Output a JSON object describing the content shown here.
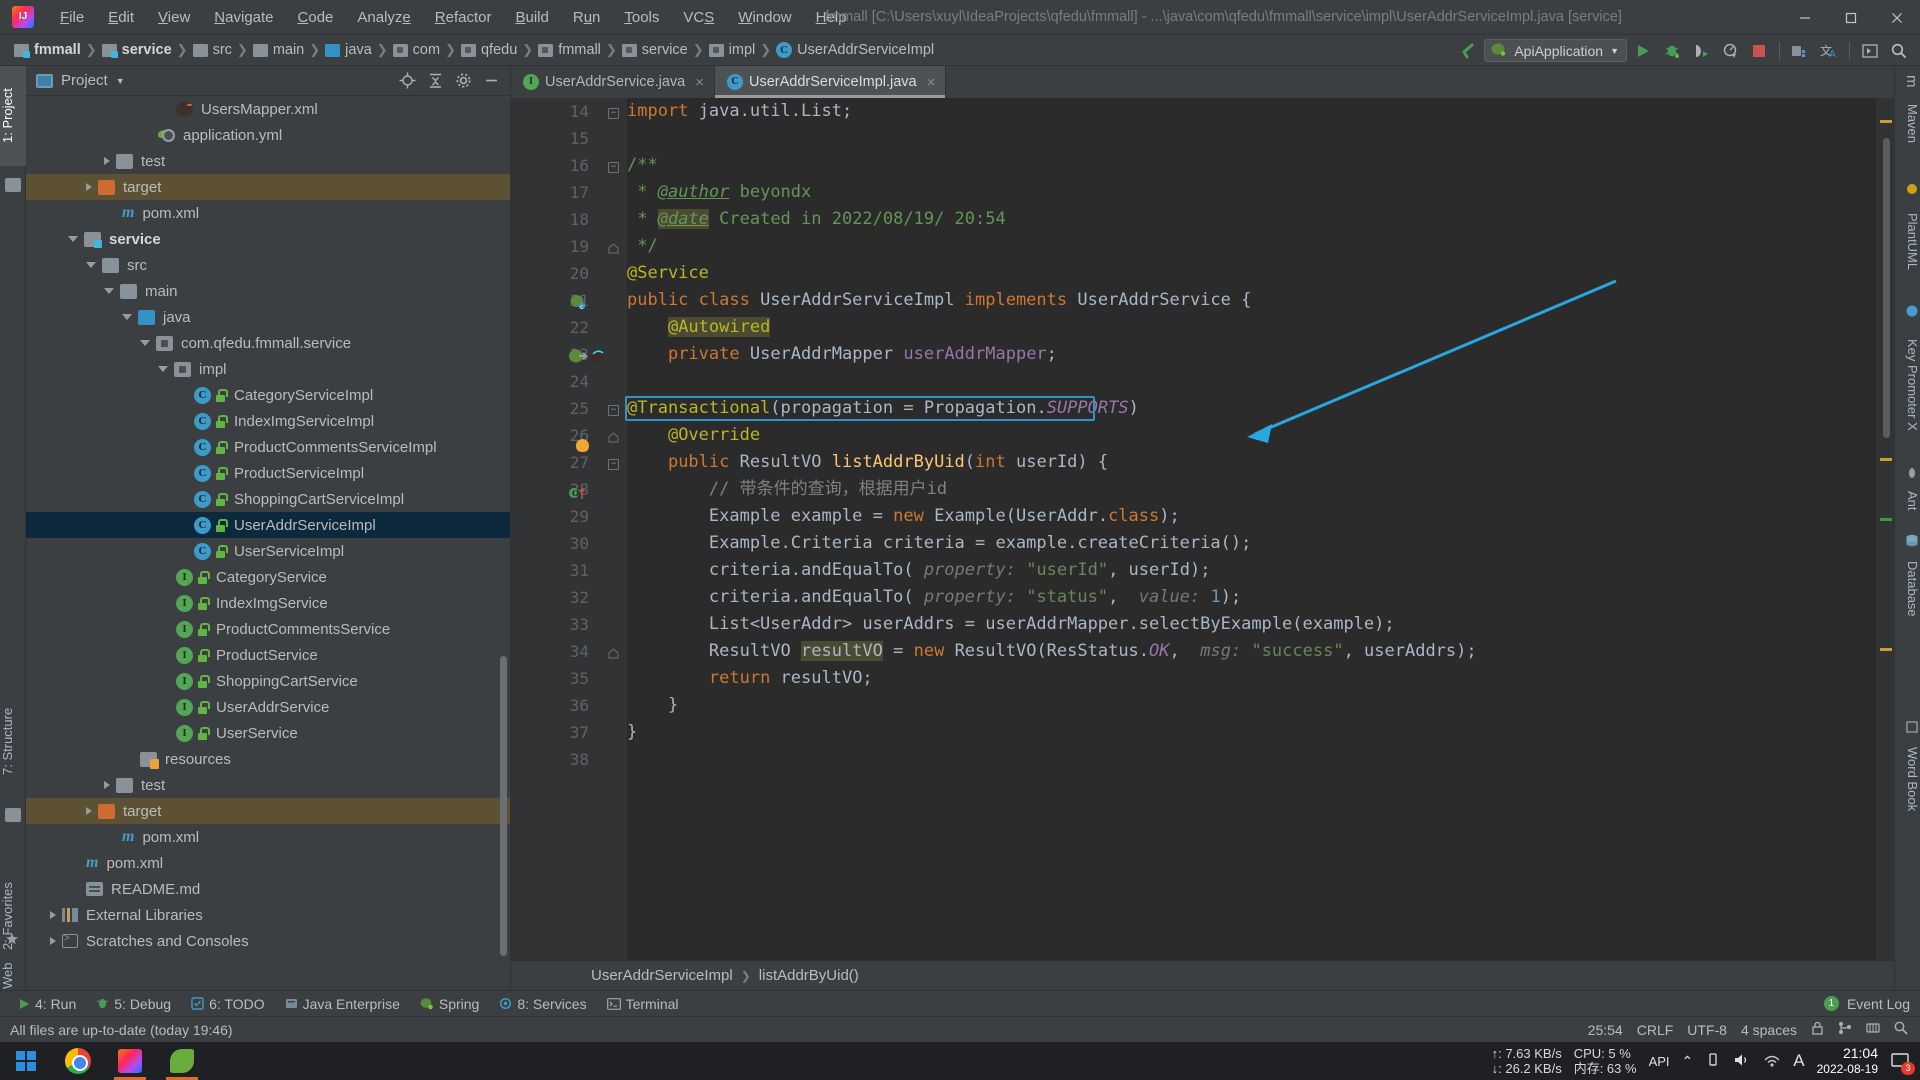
{
  "window": {
    "title": "fmmall [C:\\Users\\xuyl\\IdeaProjects\\qfedu\\fmmall] - ...\\java\\com\\qfedu\\fmmall\\service\\impl\\UserAddrServiceImpl.java [service]",
    "logo_icon": "intellij-idea-logo",
    "minimize_icon": "minimize-icon",
    "maximize_icon": "maximize-icon",
    "close_icon": "close-icon"
  },
  "menu": [
    {
      "label": "File"
    },
    {
      "label": "Edit"
    },
    {
      "label": "View"
    },
    {
      "label": "Navigate"
    },
    {
      "label": "Code"
    },
    {
      "label": "Analyze"
    },
    {
      "label": "Refactor"
    },
    {
      "label": "Build"
    },
    {
      "label": "Run"
    },
    {
      "label": "Tools"
    },
    {
      "label": "VCS"
    },
    {
      "label": "Window"
    },
    {
      "label": "Help"
    }
  ],
  "breadcrumb": [
    {
      "label": "fmmall",
      "icon": "module-icon",
      "bold": true
    },
    {
      "label": "service",
      "icon": "module-icon",
      "bold": true
    },
    {
      "label": "src",
      "icon": "folder-icon",
      "bold": false
    },
    {
      "label": "main",
      "icon": "folder-icon",
      "bold": false
    },
    {
      "label": "java",
      "icon": "source-folder-icon",
      "bold": false
    },
    {
      "label": "com",
      "icon": "package-icon",
      "bold": false
    },
    {
      "label": "qfedu",
      "icon": "package-icon",
      "bold": false
    },
    {
      "label": "fmmall",
      "icon": "package-icon",
      "bold": false
    },
    {
      "label": "service",
      "icon": "package-icon",
      "bold": false
    },
    {
      "label": "impl",
      "icon": "package-icon",
      "bold": false
    },
    {
      "label": "UserAddrServiceImpl",
      "icon": "class-icon",
      "bold": false
    }
  ],
  "toolbar": {
    "back_icon": "back-arrow-icon",
    "run_config": "ApiApplication",
    "run_config_icon": "spring-boot-icon",
    "dropdown_icon": "chevron-down-icon",
    "buttons": [
      {
        "name": "run-button",
        "icon": "play-icon"
      },
      {
        "name": "debug-button",
        "icon": "bug-icon"
      },
      {
        "name": "run-with-coverage-button",
        "icon": "coverage-icon"
      },
      {
        "name": "profile-button",
        "icon": "profiler-icon"
      },
      {
        "name": "stop-button",
        "icon": "stop-icon"
      },
      {
        "name": "project-structure-button",
        "icon": "project-structure-icon"
      },
      {
        "name": "translate-button",
        "icon": "translate-icon"
      },
      {
        "name": "layout-button",
        "icon": "layout-icon"
      },
      {
        "name": "search-everywhere-button",
        "icon": "search-icon"
      }
    ]
  },
  "left_strip": [
    {
      "label": "1: Project",
      "selected": true
    },
    {
      "label": "7: Structure",
      "selected": false
    },
    {
      "label": "2: Favorites",
      "selected": false
    },
    {
      "label": "Web",
      "selected": false
    }
  ],
  "right_strip": [
    {
      "label": "m",
      "name": "maven-tab"
    },
    {
      "label": "Maven",
      "name": "maven-label-tab"
    },
    {
      "label": "PlantUML",
      "name": "plantuml-tab"
    },
    {
      "label": "Key Promoter X",
      "name": "key-promoter-tab"
    },
    {
      "label": "Ant",
      "name": "ant-tab"
    },
    {
      "label": "Database",
      "name": "database-tab"
    },
    {
      "label": "Word Book",
      "name": "word-book-tab"
    }
  ],
  "project_panel": {
    "title": "Project",
    "dropdown_icon": "chevron-down-icon",
    "locate_icon": "locate-icon",
    "collapse_icon": "collapse-all-icon",
    "settings_icon": "gear-icon",
    "hide_icon": "hide-icon",
    "tree": [
      {
        "label": "UsersMapper.xml",
        "indent": 7,
        "icon": "xml-mapper-icon",
        "arrow": "none",
        "state": "none"
      },
      {
        "label": "application.yml",
        "indent": 6,
        "icon": "yml-icon",
        "arrow": "none",
        "state": "none"
      },
      {
        "label": "test",
        "indent": 4,
        "icon": "folder-icon",
        "arrow": "right",
        "state": "none"
      },
      {
        "label": "target",
        "indent": 3,
        "icon": "folder-orange-icon",
        "arrow": "right",
        "state": "highlighted"
      },
      {
        "label": "pom.xml",
        "indent": 4,
        "icon": "maven-icon",
        "arrow": "none",
        "state": "none"
      },
      {
        "label": "service",
        "indent": 2,
        "icon": "module-icon",
        "arrow": "down",
        "state": "bold"
      },
      {
        "label": "src",
        "indent": 3,
        "icon": "folder-icon",
        "arrow": "down",
        "state": "none"
      },
      {
        "label": "main",
        "indent": 4,
        "icon": "folder-icon",
        "arrow": "down",
        "state": "none"
      },
      {
        "label": "java",
        "indent": 5,
        "icon": "source-folder-icon",
        "arrow": "down",
        "state": "none"
      },
      {
        "label": "com.qfedu.fmmall.service",
        "indent": 6,
        "icon": "package-icon",
        "arrow": "down",
        "state": "none"
      },
      {
        "label": "impl",
        "indent": 7,
        "icon": "package-icon",
        "arrow": "down",
        "state": "none"
      },
      {
        "label": "CategoryServiceImpl",
        "indent": 8,
        "icon": "class-icon",
        "arrow": "none",
        "state": "none"
      },
      {
        "label": "IndexImgServiceImpl",
        "indent": 8,
        "icon": "class-icon",
        "arrow": "none",
        "state": "none"
      },
      {
        "label": "ProductCommentsServiceImpl",
        "indent": 8,
        "icon": "class-icon",
        "arrow": "none",
        "state": "none"
      },
      {
        "label": "ProductServiceImpl",
        "indent": 8,
        "icon": "class-icon",
        "arrow": "none",
        "state": "none"
      },
      {
        "label": "ShoppingCartServiceImpl",
        "indent": 8,
        "icon": "class-icon",
        "arrow": "none",
        "state": "none"
      },
      {
        "label": "UserAddrServiceImpl",
        "indent": 8,
        "icon": "class-icon",
        "arrow": "none",
        "state": "selected"
      },
      {
        "label": "UserServiceImpl",
        "indent": 8,
        "icon": "class-icon",
        "arrow": "none",
        "state": "none"
      },
      {
        "label": "CategoryService",
        "indent": 7,
        "icon": "interface-icon",
        "arrow": "none",
        "state": "none"
      },
      {
        "label": "IndexImgService",
        "indent": 7,
        "icon": "interface-icon",
        "arrow": "none",
        "state": "none"
      },
      {
        "label": "ProductCommentsService",
        "indent": 7,
        "icon": "interface-icon",
        "arrow": "none",
        "state": "none"
      },
      {
        "label": "ProductService",
        "indent": 7,
        "icon": "interface-icon",
        "arrow": "none",
        "state": "none"
      },
      {
        "label": "ShoppingCartService",
        "indent": 7,
        "icon": "interface-icon",
        "arrow": "none",
        "state": "none"
      },
      {
        "label": "UserAddrService",
        "indent": 7,
        "icon": "interface-icon",
        "arrow": "none",
        "state": "none"
      },
      {
        "label": "UserService",
        "indent": 7,
        "icon": "interface-icon",
        "arrow": "none",
        "state": "none"
      },
      {
        "label": "resources",
        "indent": 5,
        "icon": "resources-folder-icon",
        "arrow": "none",
        "state": "none"
      },
      {
        "label": "test",
        "indent": 4,
        "icon": "folder-icon",
        "arrow": "right",
        "state": "none"
      },
      {
        "label": "target",
        "indent": 3,
        "icon": "folder-orange-icon",
        "arrow": "right",
        "state": "highlighted"
      },
      {
        "label": "pom.xml",
        "indent": 4,
        "icon": "maven-icon",
        "arrow": "none",
        "state": "none"
      },
      {
        "label": "pom.xml",
        "indent": 2,
        "icon": "maven-icon",
        "arrow": "none",
        "state": "none"
      },
      {
        "label": "README.md",
        "indent": 2,
        "icon": "markdown-icon",
        "arrow": "none",
        "state": "none"
      },
      {
        "label": "External Libraries",
        "indent": 1,
        "icon": "library-icon",
        "arrow": "right",
        "state": "none"
      },
      {
        "label": "Scratches and Consoles",
        "indent": 1,
        "icon": "console-icon",
        "arrow": "right",
        "state": "none"
      }
    ]
  },
  "editor": {
    "tabs": [
      {
        "label": "UserAddrService.java",
        "icon": "interface-icon",
        "icon_letter": "I",
        "active": false,
        "close_icon": "close-icon"
      },
      {
        "label": "UserAddrServiceImpl.java",
        "icon": "class-icon",
        "icon_letter": "C",
        "active": true,
        "close_icon": "close-icon"
      }
    ],
    "first_line_number": 14,
    "lines": [
      {
        "num": 14,
        "html": "<span class=\"kw\">import</span> java.util.List;"
      },
      {
        "num": 15,
        "html": ""
      },
      {
        "num": 16,
        "html": "<span class=\"doc\">/**</span>"
      },
      {
        "num": 17,
        "html": "<span class=\"doc\"> * </span><span class=\"doctag\">@author</span><span class=\"doc\"> beyondx</span>"
      },
      {
        "num": 18,
        "html": "<span class=\"doc\"> * </span><span class=\"doctag hl-yellow\">@date</span><span class=\"doc\"> Created in 2022/08/19/ 20:54</span>"
      },
      {
        "num": 19,
        "html": "<span class=\"doc\"> */</span>"
      },
      {
        "num": 20,
        "html": "<span class=\"ann\">@Service</span>"
      },
      {
        "num": 21,
        "html": "<span class=\"kw\">public class </span><span class=\"typ\">UserAddrServiceImpl </span><span class=\"kw\">implements </span><span class=\"typ\">UserAddrService </span>{"
      },
      {
        "num": 22,
        "html": "    <span class=\"ann hl-yellow\">@Autowired</span>"
      },
      {
        "num": 23,
        "html": "    <span class=\"kw\">private </span><span class=\"typ\">UserAddrMapper </span><span class=\"fld\">userAddrMapper</span>;"
      },
      {
        "num": 24,
        "html": ""
      },
      {
        "num": 25,
        "html": "<span class=\"ann\">@Transactional</span>(<span class=\"param\">propagation</span> = <span class=\"typ\">Propagation</span>.<span class=\"stat\">SUPPORTS</span>)"
      },
      {
        "num": 26,
        "html": "    <span class=\"ann\">@Override</span>"
      },
      {
        "num": 27,
        "html": "    <span class=\"kw\">public </span><span class=\"typ\">ResultVO </span><span class=\"mth\">listAddrByUid</span>(<span class=\"kw\">int </span>userId) {"
      },
      {
        "num": 28,
        "html": "        <span class=\"cmt\">// 带条件的查询，根据用户id</span>"
      },
      {
        "num": 29,
        "html": "        Example example = <span class=\"kw\">new </span>Example(UserAddr.<span class=\"kw\">class</span>);"
      },
      {
        "num": 30,
        "html": "        Example.Criteria criteria = example.createCriteria();"
      },
      {
        "num": 31,
        "html": "        criteria.andEqualTo( <span class=\"hint\">property:</span> <span class=\"str\">\"userId\"</span>, userId);"
      },
      {
        "num": 32,
        "html": "        criteria.andEqualTo( <span class=\"hint\">property:</span> <span class=\"str\">\"status\"</span>,  <span class=\"hint\">value:</span> <span class=\"num\">1</span>);"
      },
      {
        "num": 33,
        "html": "        List&lt;UserAddr&gt; userAddrs = userAddrMapper.selectByExample(example);"
      },
      {
        "num": 34,
        "html": "        ResultVO <span class=\"hl-yellow\">resultVO</span> = <span class=\"kw\">new </span>ResultVO(ResStatus.<span class=\"stat\">OK</span>,  <span class=\"hint\">msg:</span> <span class=\"str\">\"success\"</span>, userAddrs);"
      },
      {
        "num": 35,
        "html": "        <span class=\"kw\">return </span>resultVO;"
      },
      {
        "num": 36,
        "html": "    }"
      },
      {
        "num": 37,
        "html": "}"
      },
      {
        "num": 38,
        "html": ""
      }
    ],
    "highlighted_line": 25,
    "highlight_border_color": "#3592c4",
    "bulb_icon": "intention-bulb-icon",
    "breadcrumb_bottom": [
      {
        "label": "UserAddrServiceImpl"
      },
      {
        "label": "listAddrByUid()"
      }
    ]
  },
  "bottom_tools": [
    {
      "label": "4: Run",
      "icon": "play-icon"
    },
    {
      "label": "5: Debug",
      "icon": "bug-icon"
    },
    {
      "label": "6: TODO",
      "icon": "todo-icon"
    },
    {
      "label": "Java Enterprise",
      "icon": "java-enterprise-icon"
    },
    {
      "label": "Spring",
      "icon": "spring-icon"
    },
    {
      "label": "8: Services",
      "icon": "services-icon"
    },
    {
      "label": "Terminal",
      "icon": "terminal-icon"
    }
  ],
  "bottom_right": {
    "event_log": "Event Log",
    "event_count": "1"
  },
  "status_bar": {
    "message": "All files are up-to-date (today 19:46)",
    "caret": "25:54",
    "line_separator": "CRLF",
    "encoding": "UTF-8",
    "indent": "4 spaces",
    "lock_icon": "lock-icon",
    "branch_icon": "branch-icon",
    "memory_icon": "memory-icon",
    "inspection_icon": "inspection-icon"
  },
  "taskbar": {
    "start_icon": "windows-start-icon",
    "apps": [
      {
        "name": "chrome-taskbar-icon",
        "icon": "chrome-icon",
        "active": false
      },
      {
        "name": "idea-taskbar-icon",
        "icon": "intellij-idea-icon",
        "active": true
      },
      {
        "name": "navicat-taskbar-icon",
        "icon": "navicat-icon",
        "active": true
      }
    ],
    "network_up": "↑: 7.63 KB/s",
    "network_down": "↓: 26.2 KB/s",
    "cpu": "CPU: 5 %",
    "memory": "内存: 63 %",
    "api_label": "API",
    "chevron_icon": "chevron-up-icon",
    "tray_icons": [
      "usb-icon",
      "volume-icon",
      "network-icon",
      "input-method-icon"
    ],
    "time": "21:04",
    "date": "2022-08-19",
    "notification_count": "3"
  },
  "colors": {
    "accent": "#3592c4",
    "editor_bg": "#2b2b2b",
    "panel_bg": "#3c3f41",
    "selection": "#0d293e",
    "highlight_row": "#5c5233",
    "arrow_annotation": "#29a8e0"
  }
}
